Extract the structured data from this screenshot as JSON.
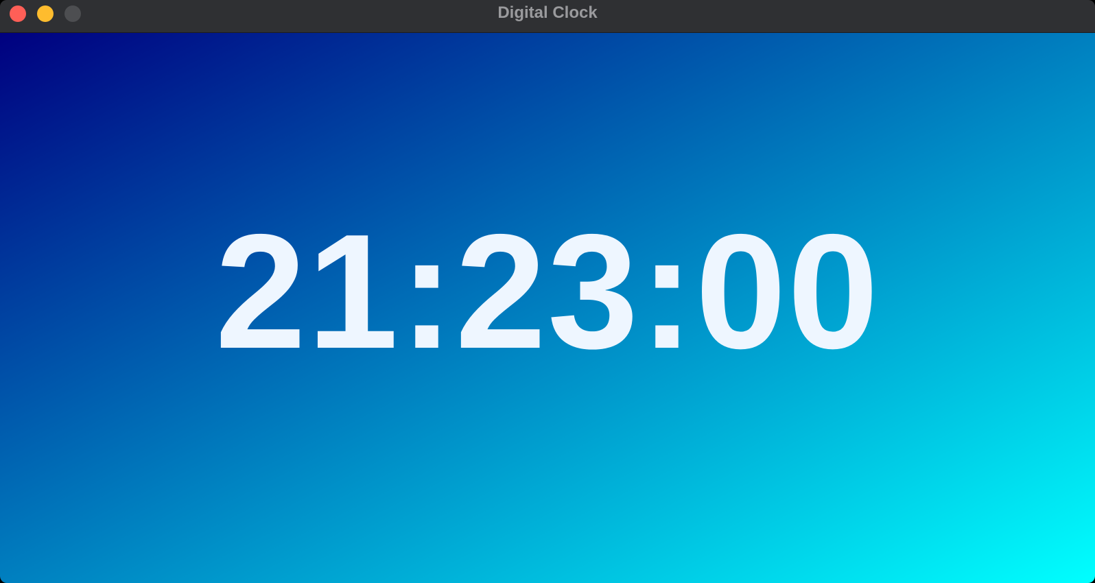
{
  "window": {
    "title": "Digital Clock",
    "controls": {
      "close_color": "#ff5f57",
      "minimize_color": "#febc2e",
      "zoom_color": "#4d4e51"
    }
  },
  "clock": {
    "time": "21:23:00",
    "text_color": "#eef6ff",
    "gradient": {
      "start": "#000080",
      "end": "#00ffff",
      "direction": "top-left to bottom-right"
    }
  }
}
